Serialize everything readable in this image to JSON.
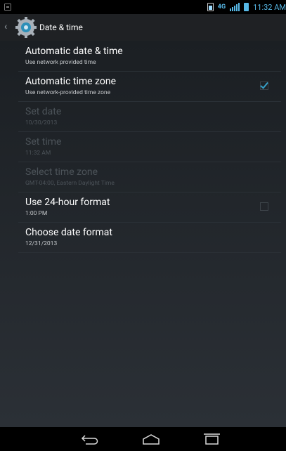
{
  "status": {
    "network_label": "4G",
    "time": "11:32 AM",
    "icons": [
      "notification-icon",
      "battery-small-icon",
      "lte-icon",
      "signal-bars-icon",
      "battery-icon"
    ]
  },
  "action_bar": {
    "title": "Date & time",
    "icon": "gear-icon",
    "up_icon": "chevron-left-icon"
  },
  "settings": [
    {
      "title": "Automatic date & time",
      "subtitle": "Use network provided time",
      "checkbox": null,
      "enabled": true
    },
    {
      "title": "Automatic time zone",
      "subtitle": "Use network-provided time zone",
      "checkbox": true,
      "enabled": true
    },
    {
      "title": "Set date",
      "subtitle": "10/30/2013",
      "checkbox": null,
      "enabled": false
    },
    {
      "title": "Set time",
      "subtitle": "11:32 AM",
      "checkbox": null,
      "enabled": false
    },
    {
      "title": "Select time zone",
      "subtitle": "GMT-04:00, Eastern Daylight Time",
      "checkbox": null,
      "enabled": false
    },
    {
      "title": "Use 24-hour format",
      "subtitle": "1:00 PM",
      "checkbox": false,
      "enabled": true
    },
    {
      "title": "Choose date format",
      "subtitle": "12/31/2013",
      "checkbox": null,
      "enabled": true
    }
  ],
  "nav": {
    "icons": [
      "back-icon",
      "home-icon",
      "recent-apps-icon"
    ]
  },
  "colors": {
    "accent": "#36a0c8",
    "background": "#1b1f23",
    "status_blue": "#57b8e6"
  }
}
